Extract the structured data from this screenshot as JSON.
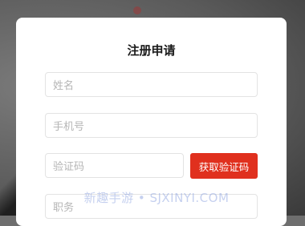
{
  "form": {
    "title": "注册申请",
    "name_placeholder": "姓名",
    "phone_placeholder": "手机号",
    "code_placeholder": "验证码",
    "get_code_label": "获取验证码",
    "position_placeholder": "职务"
  },
  "watermark": "新趣手游 • SJXINYI.COM",
  "colors": {
    "accent": "#e0301e",
    "card": "#ffffff",
    "placeholder": "#b5b5b5",
    "border": "#e3e3e3"
  }
}
